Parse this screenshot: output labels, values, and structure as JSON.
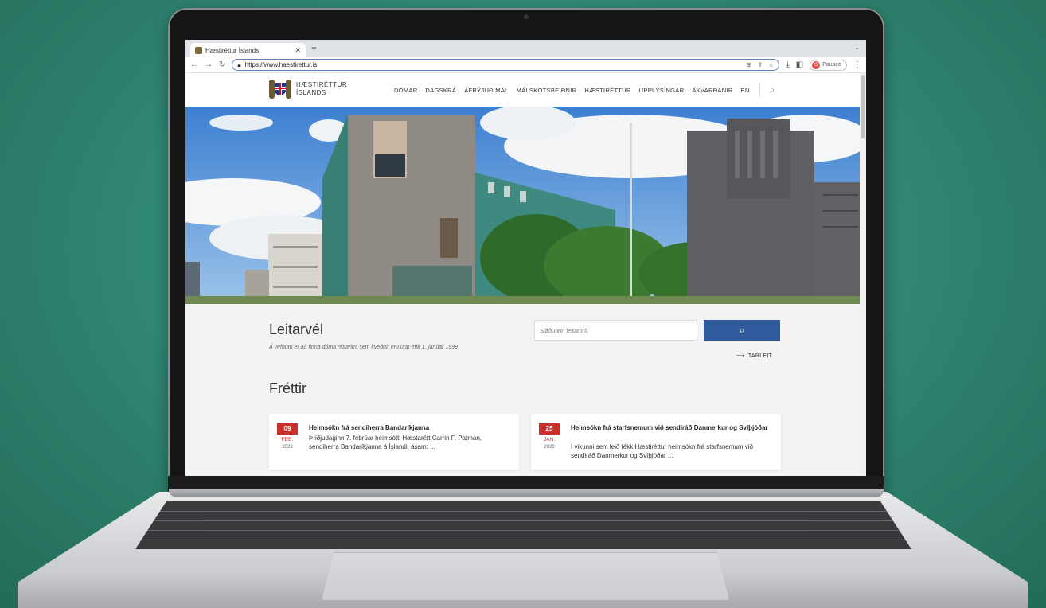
{
  "browser": {
    "tab_title": "Hæstiréttur Íslands",
    "new_tab": "+",
    "url": "https://www.haestirettur.is",
    "profile_initial": "G",
    "profile_status": "Paused"
  },
  "site": {
    "logo_line1": "HÆSTIRÉTTUR",
    "logo_line2": "ÍSLANDS",
    "nav": [
      "DÓMAR",
      "DAGSKRÁ",
      "ÁFRÝJUÐ MÁL",
      "MÁLSKOTSBEIÐNIR",
      "HÆSTIRÉTTUR",
      "UPPLÝSINGAR",
      "ÁKVARÐANIR",
      "EN"
    ]
  },
  "search": {
    "title": "Leitarvél",
    "subtitle": "Á vefnum er að finna dóma réttarins sem kveðnir eru upp eftir 1. janúar 1999",
    "placeholder": "Sláðu inn leitarorð",
    "advanced": "⟶  ÍTARLEIT"
  },
  "news": {
    "title": "Fréttir",
    "items": [
      {
        "day": "09",
        "month": "FEB.",
        "year": "2023",
        "headline": "Heimsókn frá sendiherra Bandaríkjanna",
        "body": "Þriðjudaginn 7. febrúar heimsótti Hæstarétt Carrin F. Patman, sendiherra Bandaríkjanna á Íslandi, ásamt ..."
      },
      {
        "day": "25",
        "month": "JAN.",
        "year": "2023",
        "headline": "Heimsókn frá starfsnemum við sendiráð Danmerkur og Svíþjóðar",
        "body": "Í vikunni sem leið fékk Hæstiréttur heimsókn frá starfsnemum við sendiráð Danmerkur og Svíþjóðar ..."
      }
    ]
  }
}
